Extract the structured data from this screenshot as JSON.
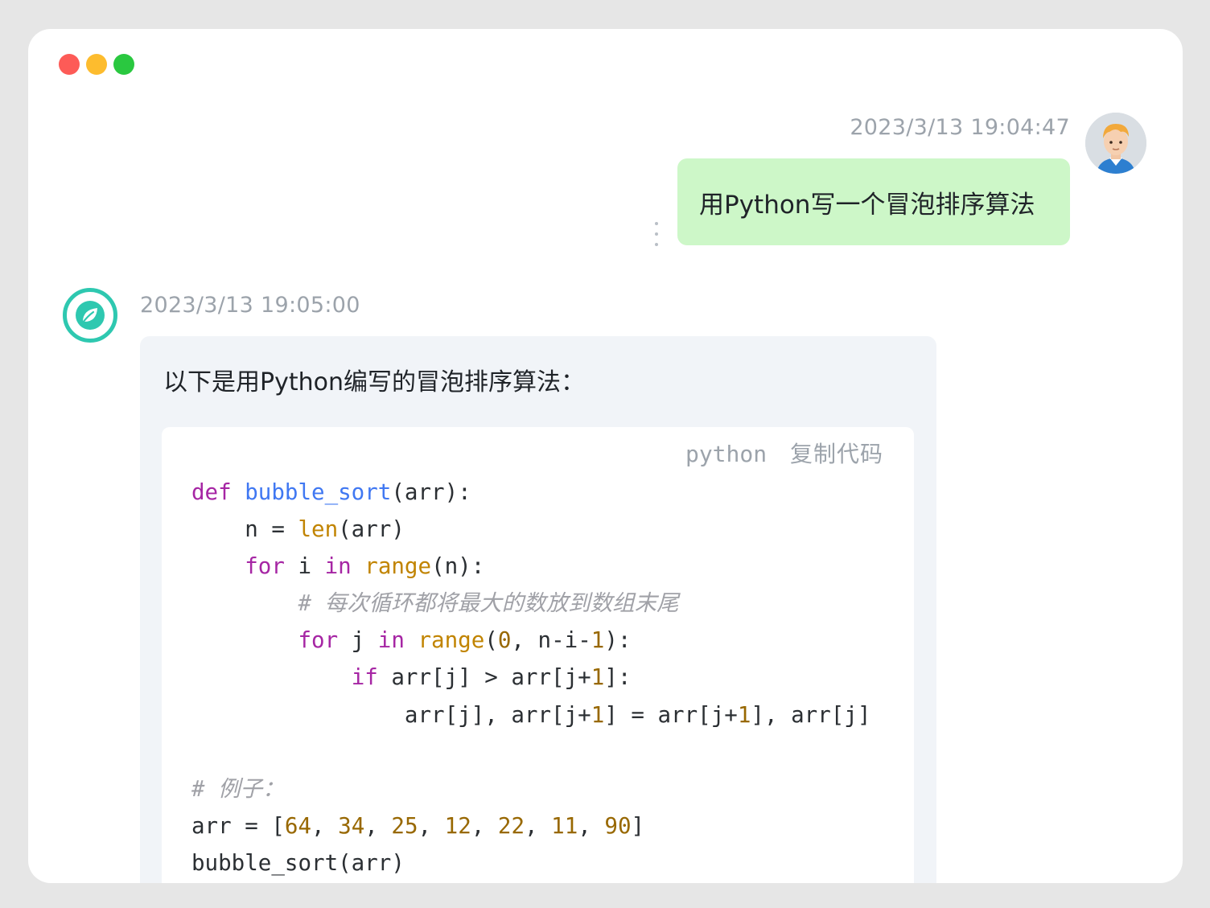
{
  "window": {
    "controls": [
      "close",
      "minimize",
      "maximize"
    ]
  },
  "user_message": {
    "timestamp": "2023/3/13 19:04:47",
    "text": "用Python写一个冒泡排序算法",
    "avatar": "user-avatar-icon"
  },
  "bot_message": {
    "timestamp": "2023/3/13 19:05:00",
    "avatar": "leaf-icon",
    "intro": "以下是用Python编写的冒泡排序算法：",
    "code_block": {
      "language": "python",
      "copy_label": "复制代码",
      "lines": [
        [
          [
            "kw",
            "def"
          ],
          [
            "p",
            " "
          ],
          [
            "fn",
            "bubble_sort"
          ],
          [
            "p",
            "(arr):"
          ]
        ],
        [
          [
            "p",
            "    n = "
          ],
          [
            "bi",
            "len"
          ],
          [
            "p",
            "(arr)"
          ]
        ],
        [
          [
            "p",
            "    "
          ],
          [
            "kw",
            "for"
          ],
          [
            "p",
            " i "
          ],
          [
            "kw",
            "in"
          ],
          [
            "p",
            " "
          ],
          [
            "bi",
            "range"
          ],
          [
            "p",
            "(n):"
          ]
        ],
        [
          [
            "p",
            "        "
          ],
          [
            "cm",
            "# 每次循环都将最大的数放到数组末尾"
          ]
        ],
        [
          [
            "p",
            "        "
          ],
          [
            "kw",
            "for"
          ],
          [
            "p",
            " j "
          ],
          [
            "kw",
            "in"
          ],
          [
            "p",
            " "
          ],
          [
            "bi",
            "range"
          ],
          [
            "p",
            "("
          ],
          [
            "num",
            "0"
          ],
          [
            "p",
            ", n-i-"
          ],
          [
            "num",
            "1"
          ],
          [
            "p",
            "):"
          ]
        ],
        [
          [
            "p",
            "            "
          ],
          [
            "kw",
            "if"
          ],
          [
            "p",
            " arr[j] > arr[j+"
          ],
          [
            "num",
            "1"
          ],
          [
            "p",
            "]:"
          ]
        ],
        [
          [
            "p",
            "                arr[j], arr[j+"
          ],
          [
            "num",
            "1"
          ],
          [
            "p",
            "] = arr[j+"
          ],
          [
            "num",
            "1"
          ],
          [
            "p",
            "], arr[j]"
          ]
        ],
        [],
        [
          [
            "cm",
            "# 例子："
          ]
        ],
        [
          [
            "p",
            "arr = ["
          ],
          [
            "num",
            "64"
          ],
          [
            "p",
            ", "
          ],
          [
            "num",
            "34"
          ],
          [
            "p",
            ", "
          ],
          [
            "num",
            "25"
          ],
          [
            "p",
            ", "
          ],
          [
            "num",
            "12"
          ],
          [
            "p",
            ", "
          ],
          [
            "num",
            "22"
          ],
          [
            "p",
            ", "
          ],
          [
            "num",
            "11"
          ],
          [
            "p",
            ", "
          ],
          [
            "num",
            "90"
          ],
          [
            "p",
            "]"
          ]
        ],
        [
          [
            "p",
            "bubble_sort(arr)"
          ]
        ]
      ]
    }
  },
  "colors": {
    "user_bubble": "#cdf7c8",
    "bot_bubble": "#f1f4f8",
    "bot_avatar_ring": "#2ec8b0",
    "keyword": "#a626a4",
    "function": "#4078f2",
    "builtin": "#c18401",
    "number": "#986801",
    "comment": "#a0a1a7"
  }
}
